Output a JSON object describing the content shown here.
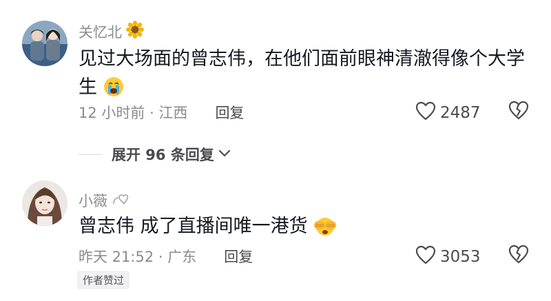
{
  "comments": [
    {
      "username": "关忆北",
      "text": "见过大场面的曾志伟，在他们面前眼神清澈得像个大学生",
      "time_location": "12 小时前 · 江西",
      "reply_label": "回复",
      "likes": "2487",
      "badge_icon": "sunflower-icon",
      "emoji_icon": "crying-face-icon"
    },
    {
      "username": "小薇",
      "text": "曾志伟 成了直播间唯一港货",
      "time_location": "昨天 21:52 · 广东",
      "reply_label": "回复",
      "likes": "3053",
      "emoji_icon": "face-with-hands-over-eyes-icon",
      "author_badge": "作者赞过"
    }
  ],
  "expand_replies": {
    "label": "展开 96 条回复"
  }
}
